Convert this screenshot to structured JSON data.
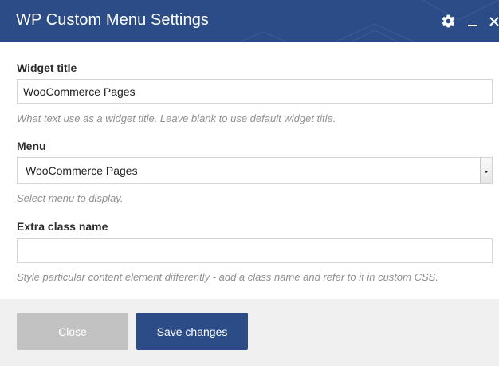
{
  "dialog": {
    "title": "WP Custom Menu Settings",
    "icons": {
      "settings": "gear-icon",
      "minimize": "minimize-icon",
      "close": "close-icon"
    }
  },
  "form": {
    "widget_title": {
      "label": "Widget title",
      "value": "WooCommerce Pages",
      "help": "What text use as a widget title. Leave blank to use default widget title."
    },
    "menu": {
      "label": "Menu",
      "selected": "WooCommerce Pages",
      "help": "Select menu to display."
    },
    "extra_class": {
      "label": "Extra class name",
      "value": "",
      "help": "Style particular content element differently - add a class name and refer to it in custom CSS."
    }
  },
  "footer": {
    "close_label": "Close",
    "save_label": "Save changes"
  },
  "colors": {
    "header": "#2b4c86",
    "primary_button": "#2b4c86",
    "disabled_button": "#c2c2c2",
    "footer_bg": "#f0f0f0"
  }
}
